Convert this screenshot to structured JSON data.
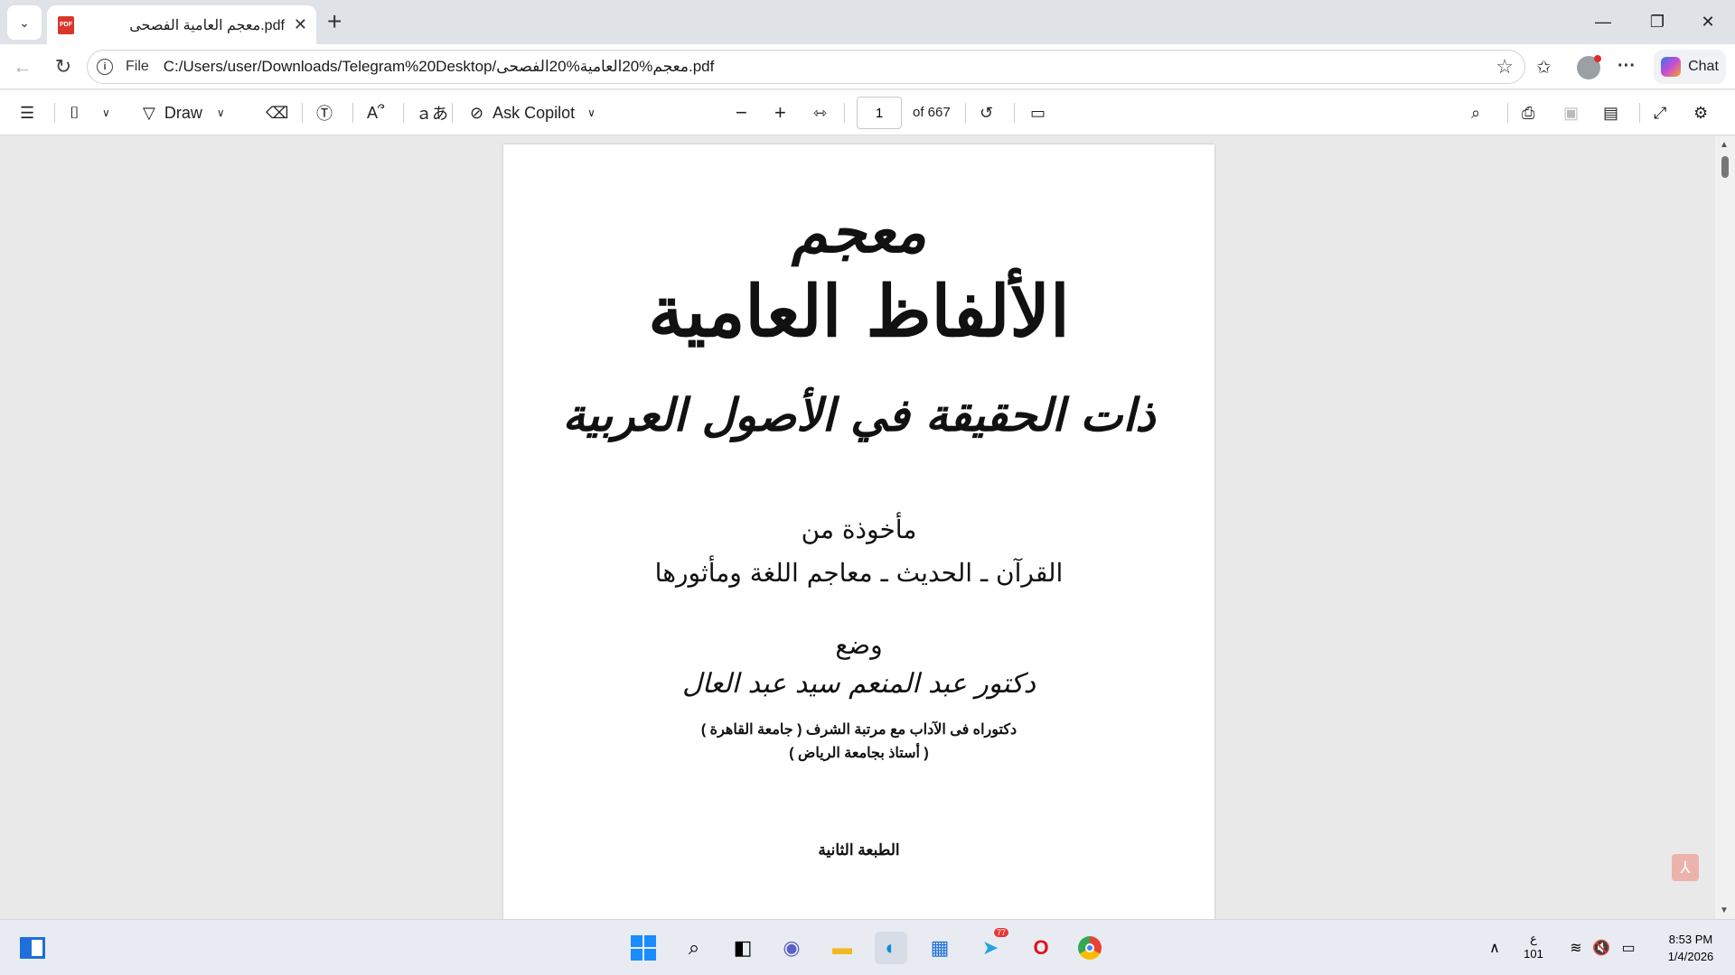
{
  "browser": {
    "tab": {
      "title": "معجم العامية الفصحى.pdf",
      "icon": "pdf-icon",
      "badge": "PDF"
    },
    "new_tab_symbol": "+",
    "window_controls": {
      "minimize": "—",
      "restore": "❐",
      "close": "✕"
    },
    "address": {
      "scheme_label": "File",
      "url": "C:/Users/user/Downloads/Telegram%20Desktop/معجم%20العامية%20الفصحى.pdf"
    },
    "chat_label": "Chat"
  },
  "pdf_toolbar": {
    "draw_label": "Draw",
    "ask_copilot_label": "Ask Copilot",
    "page_number": "1",
    "total_pages_label": "of 667"
  },
  "document": {
    "title_line1": "معجم",
    "title_line2": "الألفاظ العامية",
    "title_line3": "ذات الحقيقة في الأصول العربية",
    "source_intro": "مأخوذة من",
    "sources": "القرآن ـ الحديث ـ معاجم اللغة ومأثورها",
    "authored_label": "وضع",
    "author": "دكتور عبد المنعم سيد عبد العال",
    "credential1": "دكتوراه فى الآداب مع مرتبة الشرف ( جامعة القاهرة )",
    "credential2": "( أستاذ بجامعة الرياض )",
    "edition": "الطبعة الثانية"
  },
  "taskbar": {
    "telegram_badge": "77",
    "lang_top": "ع",
    "lang_bottom": "101",
    "time": "8:53 PM",
    "date": "1/4/2026"
  }
}
